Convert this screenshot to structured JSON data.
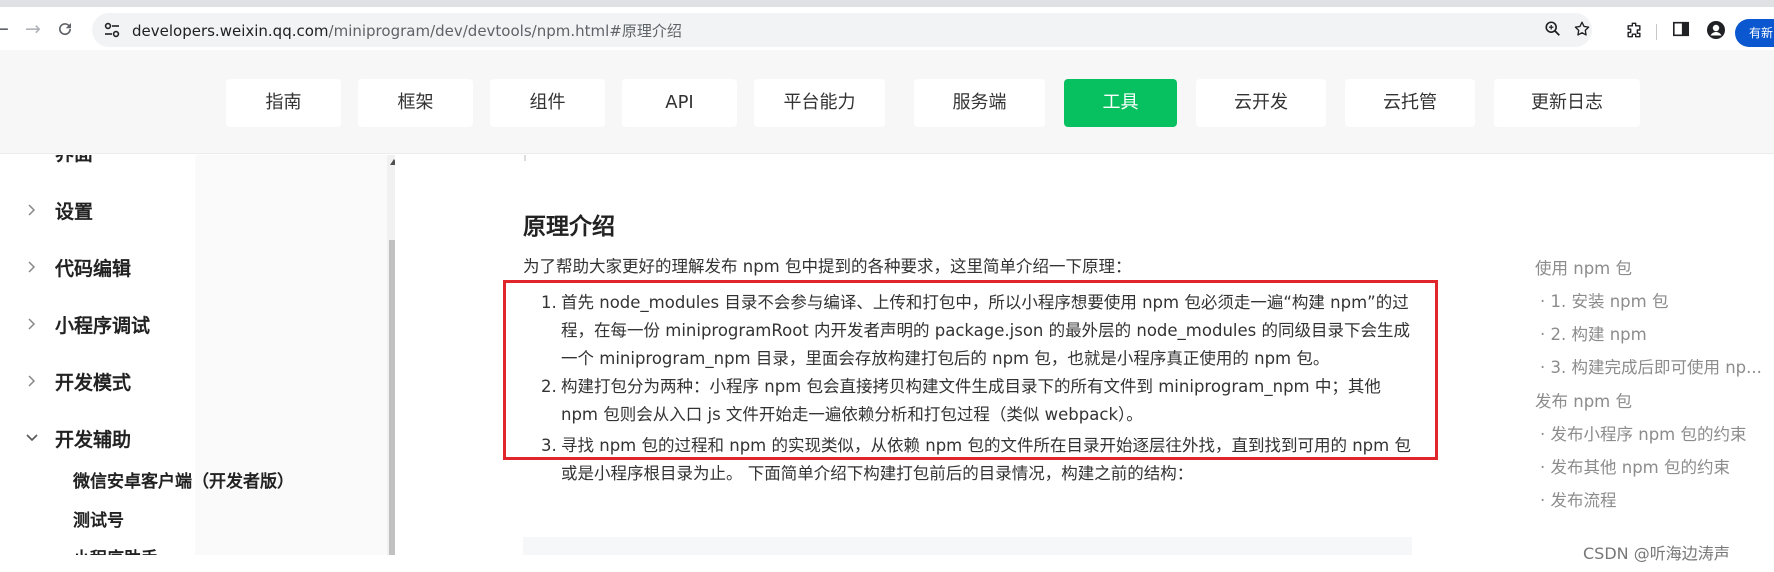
{
  "browser": {
    "url_host": "developers.weixin.qq.com",
    "url_path": "/miniprogram/dev/devtools/npm.html#原理介绍",
    "profile_button_label": "有新"
  },
  "topnav": {
    "tabs": [
      {
        "label": "指南"
      },
      {
        "label": "框架"
      },
      {
        "label": "组件"
      },
      {
        "label": "API"
      },
      {
        "label": "平台能力"
      },
      {
        "label": "服务端"
      },
      {
        "label": "工具"
      },
      {
        "label": "云开发"
      },
      {
        "label": "云托管"
      },
      {
        "label": "更新日志"
      }
    ],
    "active_index": 6,
    "active_color": "#07c160"
  },
  "sidebar": {
    "partial_top_label": "界面",
    "items": [
      {
        "label": "设置",
        "expanded": false
      },
      {
        "label": "代码编辑",
        "expanded": false
      },
      {
        "label": "小程序调试",
        "expanded": false
      },
      {
        "label": "开发模式",
        "expanded": false
      },
      {
        "label": "开发辅助",
        "expanded": true
      }
    ],
    "sub_items": [
      {
        "label": "微信安卓客户端（开发者版）"
      },
      {
        "label": "测试号"
      },
      {
        "label": "小程序助手"
      }
    ]
  },
  "content": {
    "heading": "原理介绍",
    "intro": "为了帮助大家更好的理解发布 npm 包中提到的各种要求，这里简单介绍一下原理：",
    "list": [
      {
        "num": "1.",
        "text": "首先 node_modules 目录不会参与编译、上传和打包中，所以小程序想要使用 npm 包必须走一遍“构建 npm”的过程，在每一份 miniprogramRoot 内开发者声明的 package.json 的最外层的 node_modules 的同级目录下会生成一个 miniprogram_npm 目录，里面会存放构建打包后的 npm 包，也就是小程序真正使用的 npm 包。"
      },
      {
        "num": "2.",
        "text": "构建打包分为两种：小程序 npm 包会直接拷贝构建文件生成目录下的所有文件到 miniprogram_npm 中；其他 npm 包则会从入口 js 文件开始走一遍依赖分析和打包过程（类似 webpack）。"
      },
      {
        "num": "3.",
        "text": "寻找 npm 包的过程和 npm 的实现类似，从依赖 npm 包的文件所在目录开始逐层往外找，直到找到可用的 npm 包或是小程序根目录为止。 下面简单介绍下构建打包前后的目录情况，构建之前的结构："
      }
    ],
    "highlight_color": "#e0252b"
  },
  "toc": {
    "items": [
      {
        "label": "使用 npm 包"
      },
      {
        "label": "· 1. 安装 npm 包"
      },
      {
        "label": "· 2. 构建 npm"
      },
      {
        "label": "· 3. 构建完成后即可使用 np..."
      },
      {
        "label": "发布 npm 包"
      },
      {
        "label": "· 发布小程序 npm 包的约束"
      },
      {
        "label": "· 发布其他 npm 包的约束"
      },
      {
        "label": "· 发布流程"
      }
    ]
  },
  "watermark": "CSDN @听海边涛声"
}
